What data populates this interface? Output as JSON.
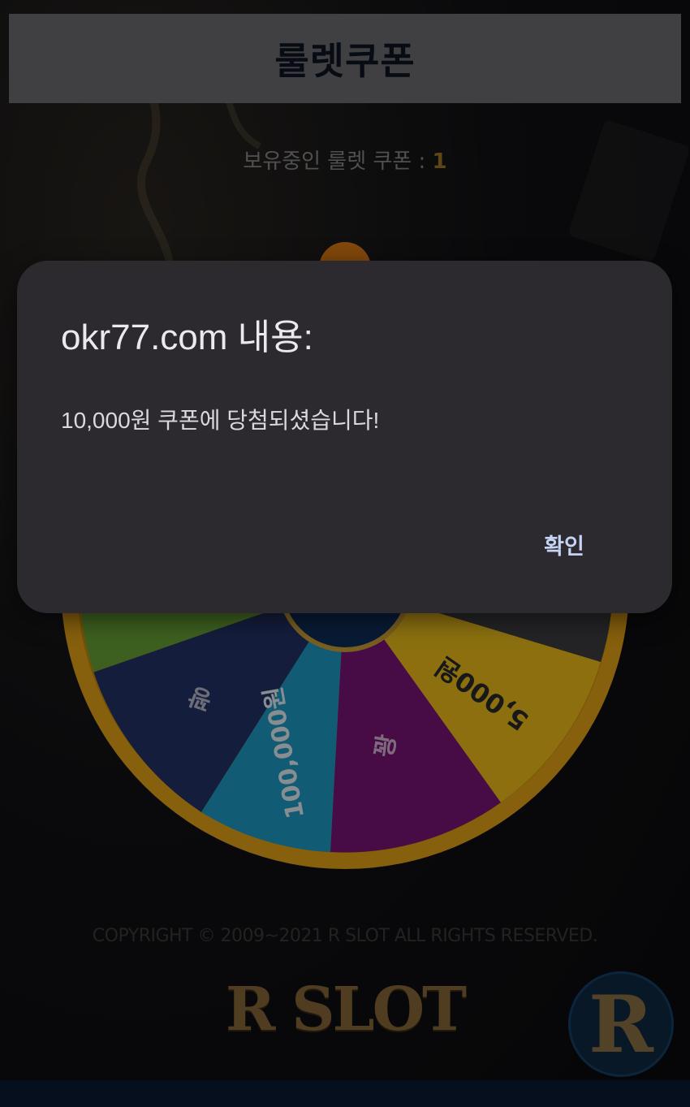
{
  "header": {
    "title": "룰렛쿠폰"
  },
  "coupon": {
    "label": "보유중인 룰렛 쿠폰 : ",
    "count": "1"
  },
  "wheel": {
    "segments": [
      {
        "label": "꽝",
        "color": "#233366"
      },
      {
        "label": "100,000원",
        "color": "#1e9ec9"
      },
      {
        "label": "꽝",
        "color": "#7b1478"
      },
      {
        "label": "5,000원",
        "color": "#f1c21d"
      }
    ],
    "other_colors": {
      "green": "#6aa537",
      "rim": "#e7a616",
      "hub": "#0f2f5c"
    }
  },
  "footer": {
    "copyright": "COPYRIGHT © 2009~2021 R SLOT ALL RIGHTS RESERVED.",
    "logo": "R SLOT",
    "fab_letter": "R"
  },
  "dialog": {
    "title": "okr77.com 내용:",
    "message": "10,000원 쿠폰에 당첨되셨습니다!",
    "ok_label": "확인"
  }
}
